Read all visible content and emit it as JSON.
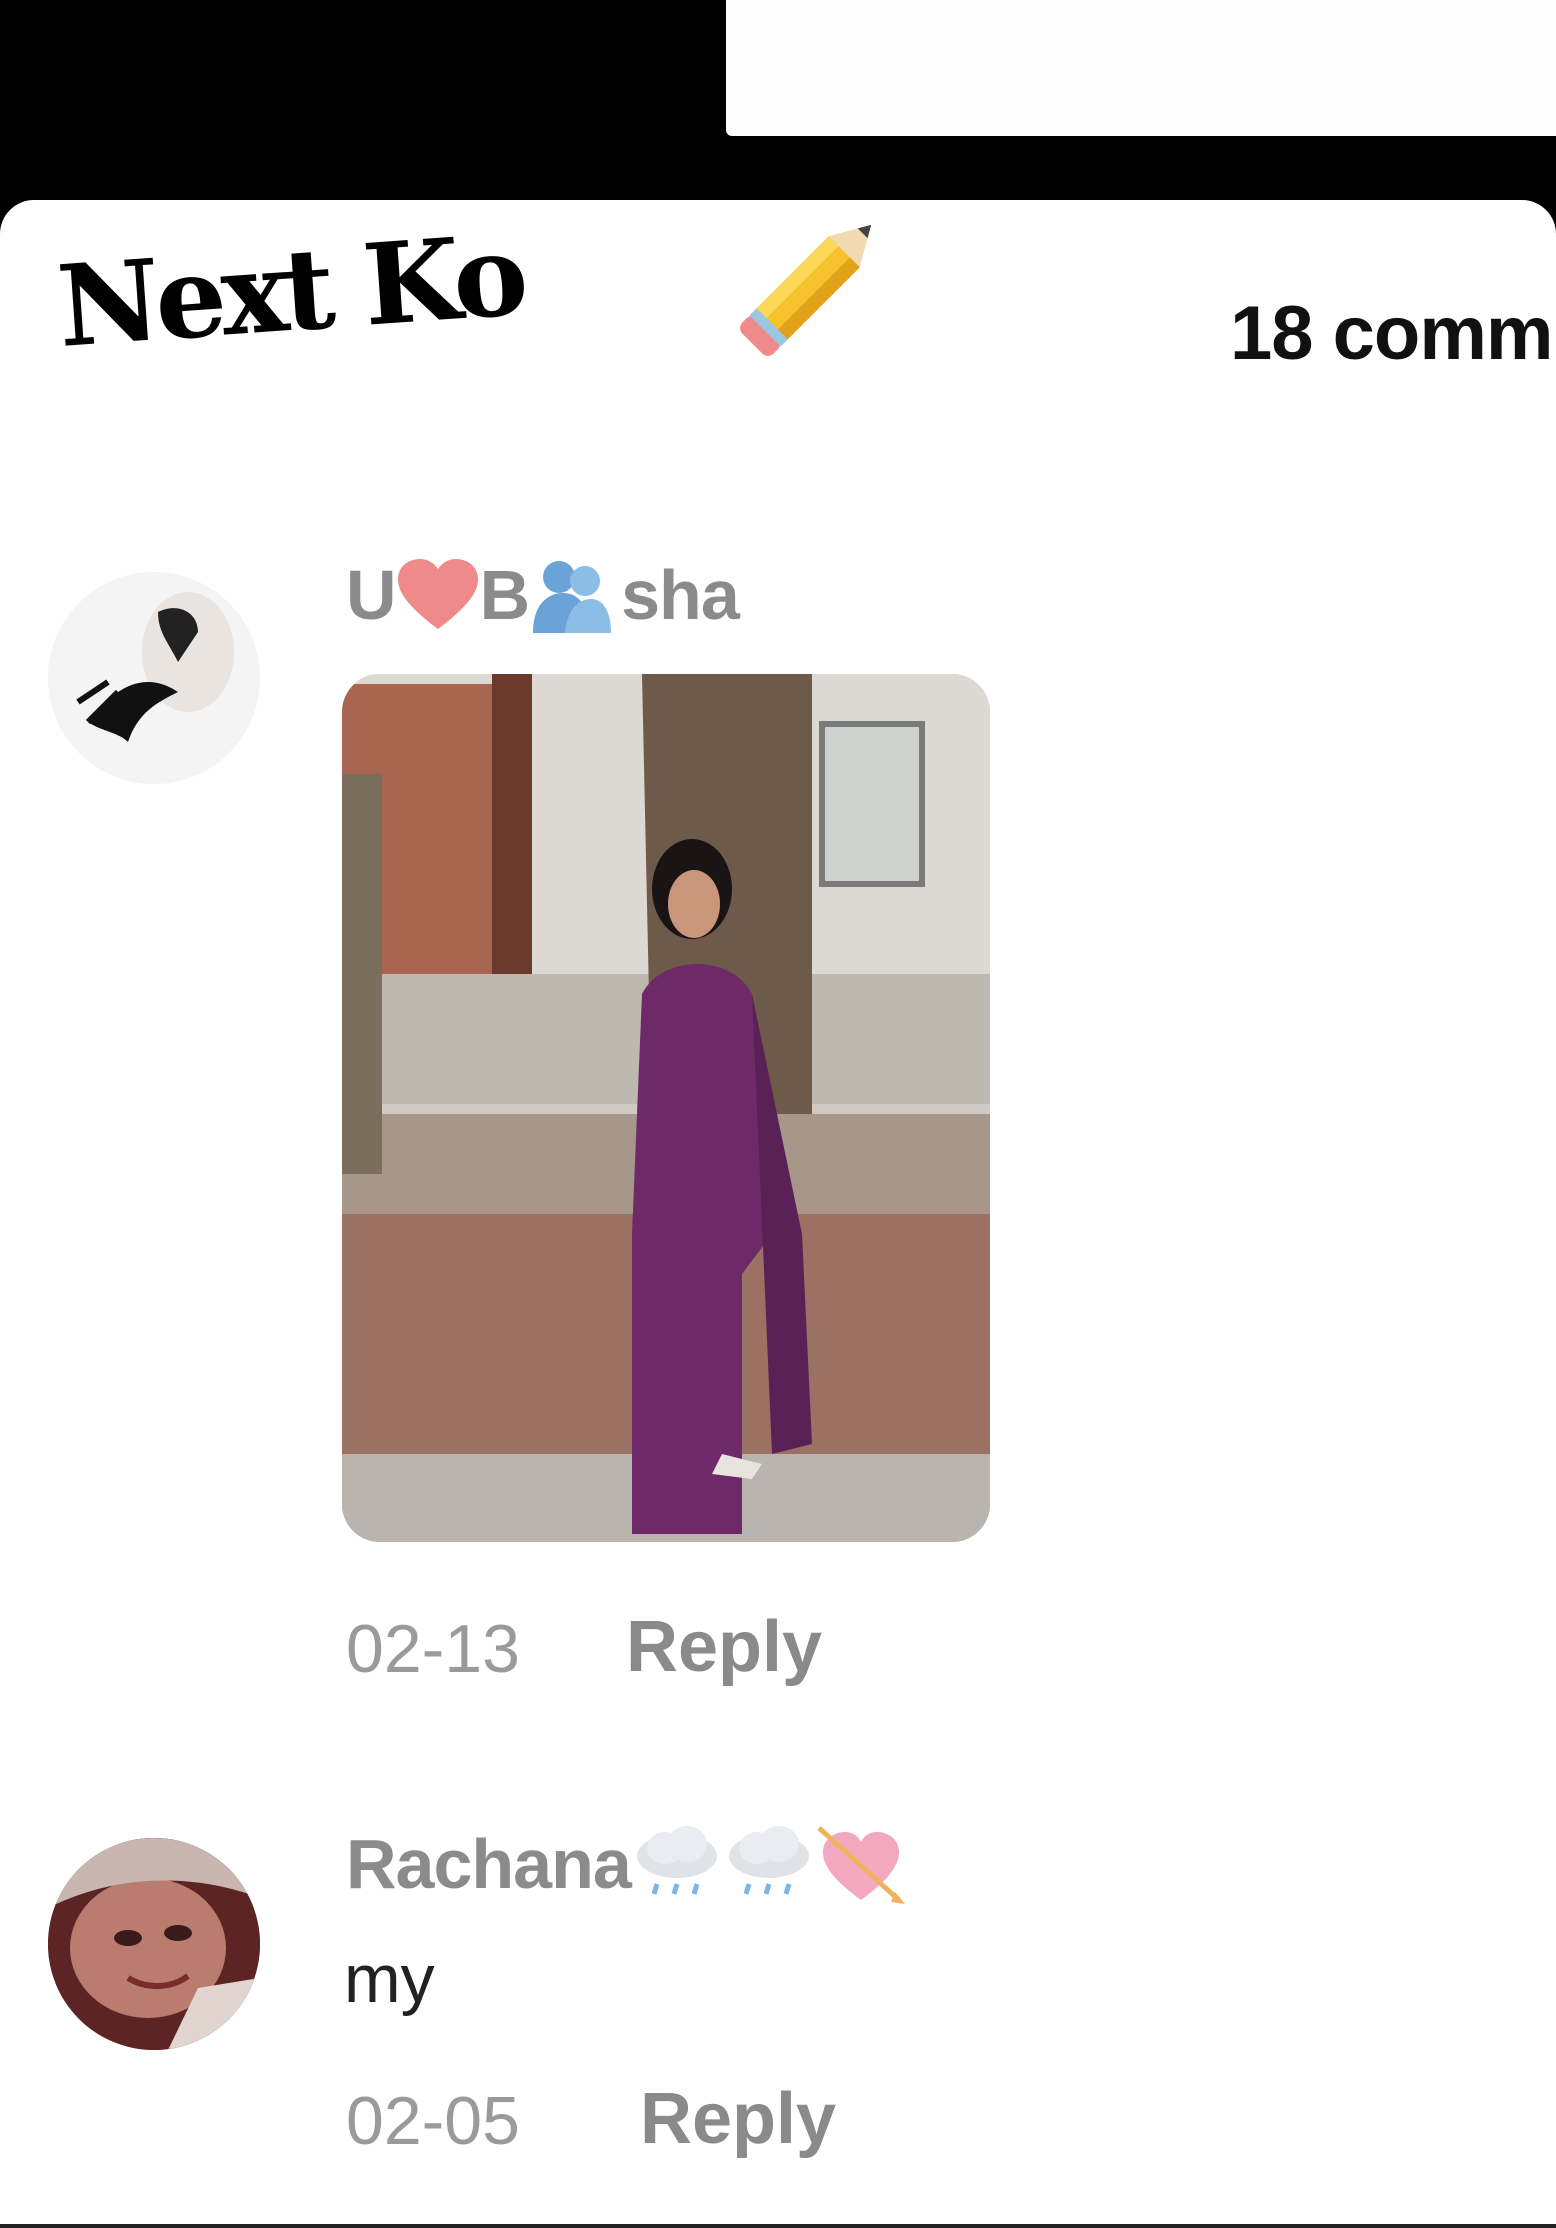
{
  "overlay": {
    "title": "Next Ko",
    "pencil_icon": "pencil-icon"
  },
  "header": {
    "comment_count": "18 comm"
  },
  "comments": [
    {
      "username_parts": [
        "U",
        "heart-emoji",
        "B",
        "people-hugging-emoji",
        "sha"
      ],
      "username_text_1": "U",
      "username_text_2": "B",
      "username_text_3": "sha",
      "attachment": "photo",
      "date": "02-13",
      "reply_label": "Reply"
    },
    {
      "username_text": "Rachana",
      "username_emojis": [
        "cloud-rain-emoji",
        "cloud-rain-emoji",
        "heart-arrow-emoji"
      ],
      "text": "my",
      "date": "02-05",
      "reply_label": "Reply"
    }
  ],
  "colors": {
    "background": "#000000",
    "sheet": "#ffffff",
    "username": "#8b8b8b",
    "meta": "#9a9a9a",
    "heart": "#f08a8a",
    "saree": "#6e2a68"
  }
}
